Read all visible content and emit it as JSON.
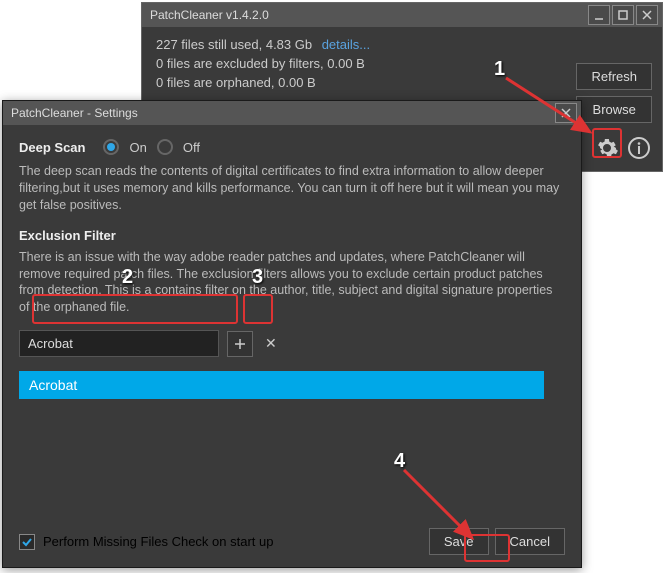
{
  "main": {
    "title": "PatchCleaner v1.4.2.0",
    "status1_prefix": "227 files still used, 4.83 Gb ",
    "details": "details...",
    "status2": "0 files are excluded by filters, 0.00 B",
    "status3": "0 files are orphaned, 0.00 B",
    "refresh": "Refresh",
    "browse": "Browse"
  },
  "settings": {
    "title": "PatchCleaner - Settings",
    "deep_scan_title": "Deep Scan",
    "on": "On",
    "off": "Off",
    "deep_scan_desc": "The deep scan reads the contents of digital certificates to find extra information to allow deeper filtering,but it uses memory and kills performance. You can turn it off here but it will mean you may get false positives.",
    "exclusion_title": "Exclusion Filter",
    "exclusion_desc": "There is an issue with the way adobe reader patches and updates, where PatchCleaner will remove required patch files. The exclusion filters allows you to exclude certain product patches from detection. This is a contains filter on the author, title, subject and digital signature properties of the orphaned file.",
    "filter_input": "Acrobat",
    "filter_item": "Acrobat",
    "startup_check": "Perform Missing Files Check on start up",
    "save": "Save",
    "cancel": "Cancel"
  },
  "annotations": {
    "n1": "1",
    "n2": "2",
    "n3": "3",
    "n4": "4"
  }
}
